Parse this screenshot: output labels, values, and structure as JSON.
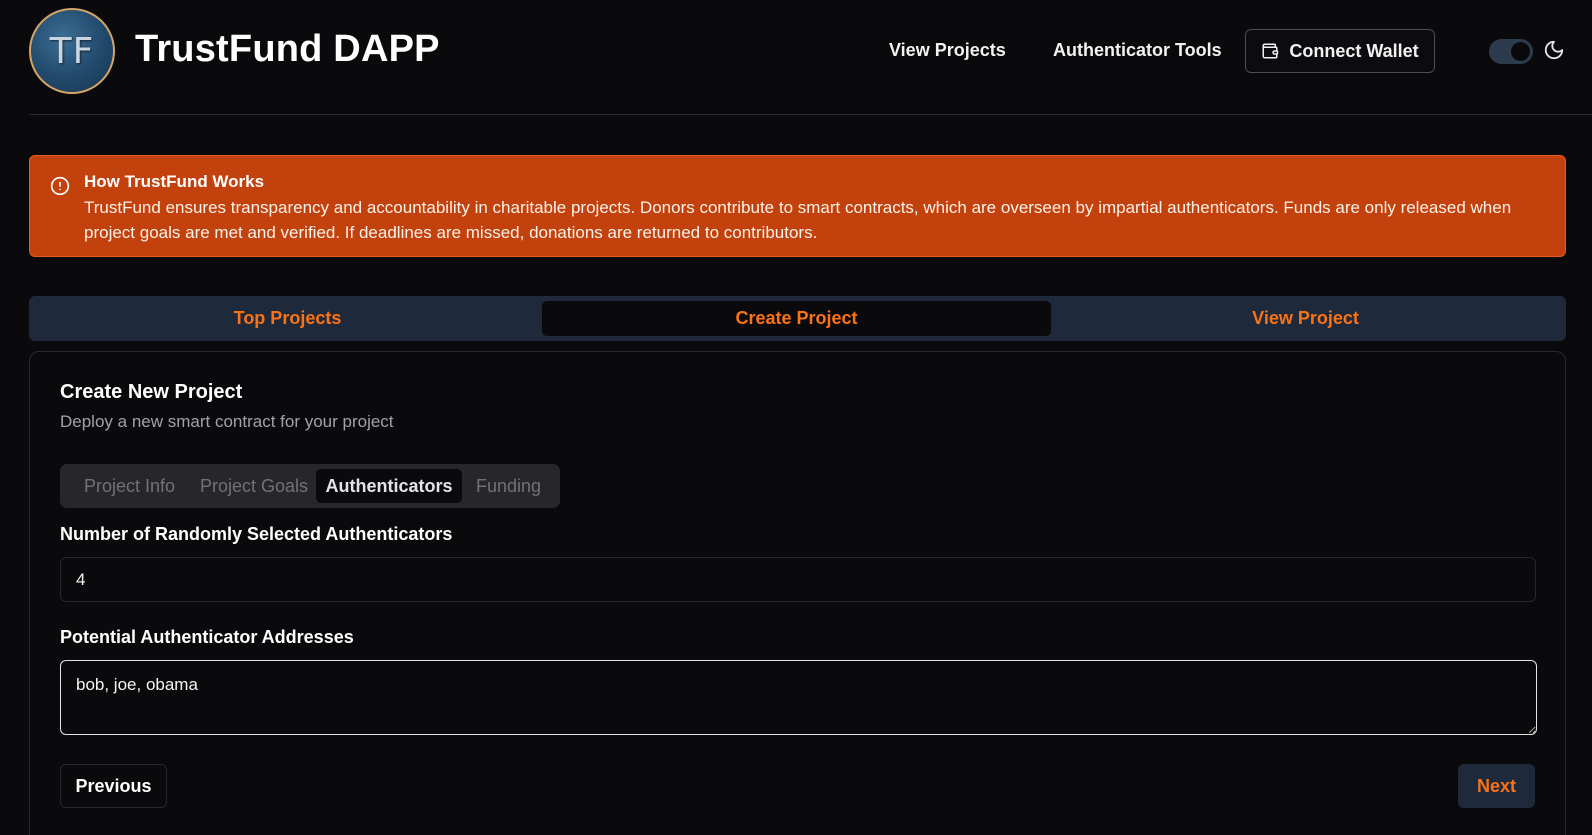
{
  "header": {
    "logo_text": "TF",
    "title": "TrustFund DAPP",
    "nav": {
      "view_projects": "View Projects",
      "authenticator_tools": "Authenticator Tools"
    },
    "connect_wallet_label": "Connect Wallet",
    "connect_wallet_icon": "wallet-icon",
    "theme_toggle_icon": "moon-icon",
    "theme_toggle_on": true
  },
  "alert": {
    "icon": "alert-circle-icon",
    "title": "How TrustFund Works",
    "body": "TrustFund ensures transparency and accountability in charitable projects. Donors contribute to smart contracts, which are overseen by impartial authenticators. Funds are only released when project goals are met and verified. If deadlines are missed, donations are returned to contributors."
  },
  "main_tabs": [
    {
      "label": "Top Projects",
      "active": false
    },
    {
      "label": "Create Project",
      "active": true
    },
    {
      "label": "View Project",
      "active": false
    }
  ],
  "card": {
    "title": "Create New Project",
    "subtitle": "Deploy a new smart contract for your project",
    "steps": [
      {
        "label": "Project Info",
        "active": false
      },
      {
        "label": "Project Goals",
        "active": false
      },
      {
        "label": "Authenticators",
        "active": true
      },
      {
        "label": "Funding",
        "active": false
      }
    ],
    "num_authenticators": {
      "label": "Number of Randomly Selected Authenticators",
      "value": "4"
    },
    "authenticator_addresses": {
      "label": "Potential Authenticator Addresses",
      "value": "bob, joe, obama"
    },
    "previous_label": "Previous",
    "next_label": "Next"
  },
  "colors": {
    "background": "#0a0a0d",
    "accent": "#f97316",
    "alert_bg": "#c2410c",
    "tab_bar_bg": "#1e293b"
  }
}
